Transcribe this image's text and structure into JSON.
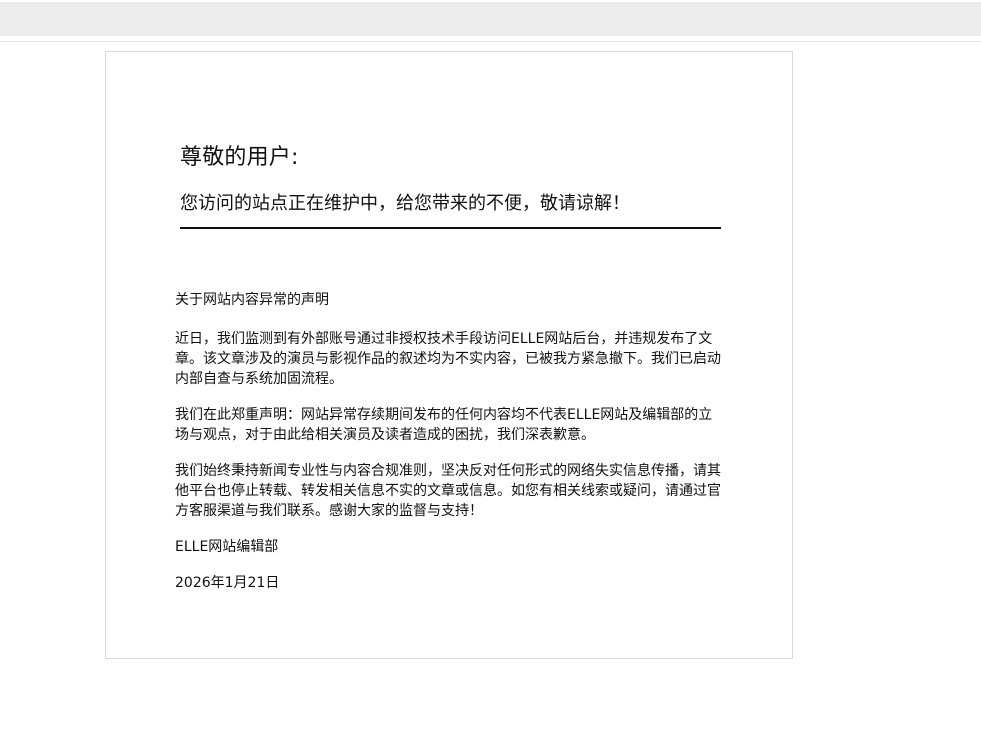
{
  "header": {
    "greeting": "尊敬的用户:",
    "notice": "您访问的站点正在维护中，给您带来的不便，敬请谅解！"
  },
  "statement": {
    "title": "关于网站内容异常的声明",
    "paragraphs": [
      "近日，我们监测到有外部账号通过非授权技术手段访问ELLE网站后台，并违规发布了文章。该文章涉及的演员与影视作品的叙述均为不实内容，已被我方紧急撤下。我们已启动内部自查与系统加固流程。",
      "我们在此郑重声明：网站异常存续期间发布的任何内容均不代表ELLE网站及编辑部的立场与观点，对于由此给相关演员及读者造成的困扰，我们深表歉意。",
      "我们始终秉持新闻专业性与内容合规准则，坚决反对任何形式的网络失实信息传播，请其他平台也停止转载、转发相关信息不实的文章或信息。如您有相关线索或疑问，请通过官方客服渠道与我们联系。感谢大家的监督与支持！"
    ],
    "signature": "ELLE网站编辑部",
    "date": "2026年1月21日"
  }
}
